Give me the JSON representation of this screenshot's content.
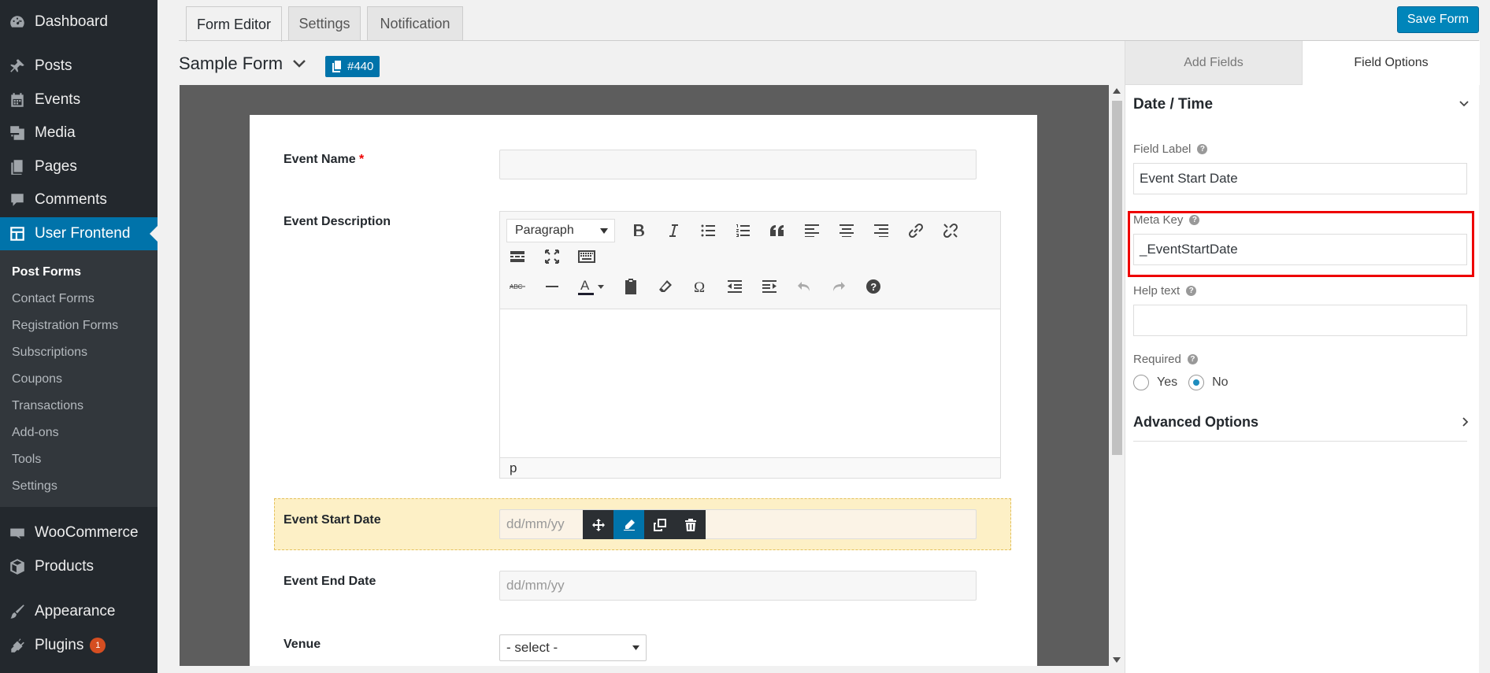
{
  "sidebar": {
    "items": [
      {
        "label": "Dashboard",
        "icon": "dashboard-icon"
      },
      {
        "label": "Posts",
        "icon": "pin-icon"
      },
      {
        "label": "Events",
        "icon": "calendar-icon"
      },
      {
        "label": "Media",
        "icon": "media-icon"
      },
      {
        "label": "Pages",
        "icon": "pages-icon"
      },
      {
        "label": "Comments",
        "icon": "comment-icon"
      },
      {
        "label": "User Frontend",
        "icon": "layout-icon"
      },
      {
        "label": "WooCommerce",
        "icon": "woo-icon"
      },
      {
        "label": "Products",
        "icon": "box-icon"
      },
      {
        "label": "Appearance",
        "icon": "brush-icon"
      },
      {
        "label": "Plugins",
        "icon": "plug-icon"
      }
    ],
    "plugins_badge": "1",
    "submenu": [
      "Post Forms",
      "Contact Forms",
      "Registration Forms",
      "Subscriptions",
      "Coupons",
      "Transactions",
      "Add-ons",
      "Tools",
      "Settings"
    ]
  },
  "tabs": [
    "Form Editor",
    "Settings",
    "Notification"
  ],
  "save_label": "Save Form",
  "form": {
    "title": "Sample Form",
    "shortcode": "#440"
  },
  "fields": {
    "event_name": "Event Name",
    "required_mark": "*",
    "event_description": "Event Description",
    "event_start_date": "Event Start Date",
    "event_end_date": "Event End Date",
    "venue": "Venue",
    "date_placeholder": "dd/mm/yy",
    "venue_select": "- select -"
  },
  "editor": {
    "format": "Paragraph",
    "status_path": "p"
  },
  "right_panel": {
    "tabs": [
      "Add Fields",
      "Field Options"
    ],
    "section": "Date / Time",
    "field_label_label": "Field Label",
    "field_label_value": "Event Start Date",
    "meta_key_label": "Meta Key",
    "meta_key_value": "_EventStartDate",
    "help_text_label": "Help text",
    "help_text_value": "",
    "required_label": "Required",
    "required_yes": "Yes",
    "required_no": "No",
    "required_selected": "No",
    "advanced": "Advanced Options"
  },
  "colors": {
    "sidebar_bg": "#23282d",
    "active_menu": "#0073aa",
    "primary_button": "#0085ba",
    "highlight_border": "#ee0000",
    "selected_field_bg": "#fdf0c6"
  }
}
